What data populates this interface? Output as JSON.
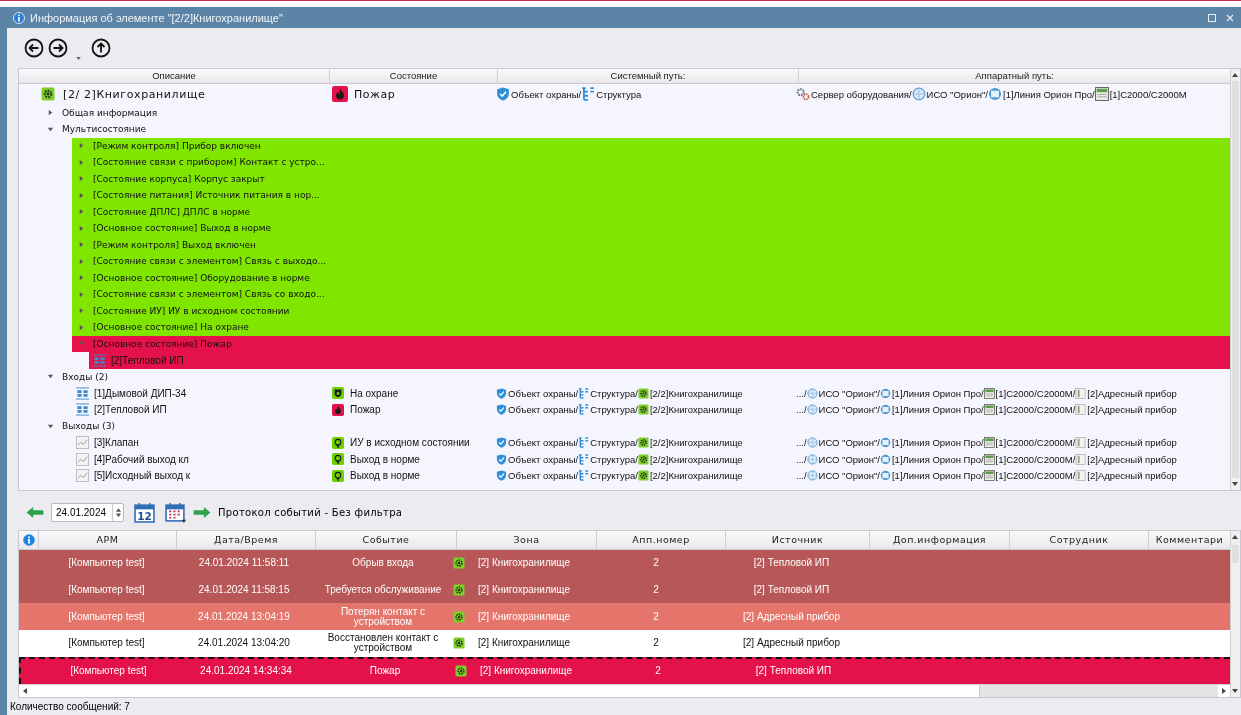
{
  "window": {
    "title": "Информация об элементе \"[2/2]Книгохранилище\""
  },
  "tree_columns": [
    "Описание",
    "Состояние",
    "Системный путь:",
    "Аппаратный путь:"
  ],
  "element": {
    "name": "[2/ 2]Книгохранилище",
    "status": {
      "kind": "fire",
      "text": "Пожар"
    },
    "sys_path": [
      {
        "kind": "shield",
        "text": "Объект охраны/"
      },
      {
        "kind": "structure",
        "text": "Структура"
      }
    ],
    "hw_path": [
      {
        "kind": "gears",
        "text": "Сервер оборудования/"
      },
      {
        "kind": "orion",
        "text": "ИСО \"Орион\"/"
      },
      {
        "kind": "line",
        "text": "[1]Линия Орион Про/"
      },
      {
        "kind": "device",
        "text": "[1]С2000/С2000М"
      }
    ]
  },
  "tree": [
    {
      "label": "Общая информация",
      "expanded": false
    },
    {
      "label": "Мультисостояние",
      "expanded": true,
      "children": [
        {
          "label": "[Режим контроля] Прибор включен",
          "expanded": false,
          "color": "#80e600"
        },
        {
          "label": "[Состояние связи с прибором] Контакт с устро...",
          "expanded": false,
          "color": "#80e600"
        },
        {
          "label": "[Состояние корпуса] Корпус закрыт",
          "expanded": false,
          "color": "#80e600"
        },
        {
          "label": "[Состояние питания] Источник питания в нор...",
          "expanded": false,
          "color": "#80e600"
        },
        {
          "label": "[Состояние ДПЛС] ДПЛС в норме",
          "expanded": false,
          "color": "#80e600"
        },
        {
          "label": "[Основное состояние] Выход в норме",
          "expanded": false,
          "color": "#80e600"
        },
        {
          "label": "[Режим контроля] Выход включен",
          "expanded": false,
          "color": "#80e600"
        },
        {
          "label": "[Состояние связи с элементом] Связь с выходо...",
          "expanded": false,
          "color": "#80e600"
        },
        {
          "label": "[Основное состояние] Оборудование в норме",
          "expanded": false,
          "color": "#80e600"
        },
        {
          "label": "[Состояние связи с элементом] Связь со входо...",
          "expanded": false,
          "color": "#80e600"
        },
        {
          "label": "[Состояние ИУ] ИУ в исходном состоянии",
          "expanded": false,
          "color": "#80e600"
        },
        {
          "label": "[Основное состояние] На охране",
          "expanded": false,
          "color": "#80e600"
        },
        {
          "label": "[Основное состояние] Пожар",
          "expanded": true,
          "color": "#e5114a",
          "children": [
            {
              "label": "[2]Тепловой ИП",
              "kind": "sensor",
              "color": "#e5114a"
            }
          ]
        }
      ]
    },
    {
      "label": "Входы (2)",
      "expanded": true,
      "children": [
        {
          "label": "[1]Дымовой ДИП-34",
          "kind": "sensor",
          "status": {
            "kind": "guard",
            "text": "На охране"
          },
          "sys_path": [
            {
              "kind": "shield",
              "text": "Объект охраны/"
            },
            {
              "kind": "structure",
              "text": "Структура/"
            },
            {
              "kind": "zone",
              "text": "[2/2]Книгохранилище"
            }
          ],
          "hw_path": [
            {
              "kind": "none",
              "text": ".../"
            },
            {
              "kind": "orion",
              "text": "ИСО \"Орион\"/"
            },
            {
              "kind": "line",
              "text": "[1]Линия Орион Про/"
            },
            {
              "kind": "device",
              "text": "[1]С2000/С2000М/"
            },
            {
              "kind": "addr",
              "text": "[2]Адресный прибор"
            }
          ]
        },
        {
          "label": "[2]Тепловой ИП",
          "kind": "sensor",
          "status": {
            "kind": "fire",
            "text": "Пожар"
          },
          "sys_path": [
            {
              "kind": "shield",
              "text": "Объект охраны/"
            },
            {
              "kind": "structure",
              "text": "Структура/"
            },
            {
              "kind": "zone",
              "text": "[2/2]Книгохранилище"
            }
          ],
          "hw_path": [
            {
              "kind": "none",
              "text": ".../"
            },
            {
              "kind": "orion",
              "text": "ИСО \"Орион\"/"
            },
            {
              "kind": "line",
              "text": "[1]Линия Орион Про/"
            },
            {
              "kind": "device",
              "text": "[1]С2000/С2000М/"
            },
            {
              "kind": "addr",
              "text": "[2]Адресный прибор"
            }
          ]
        }
      ]
    },
    {
      "label": "Выходы (3)",
      "expanded": true,
      "children": [
        {
          "label": "[3]Клапан",
          "kind": "output",
          "status": {
            "kind": "bulb",
            "text": "ИУ в исходном состоянии"
          },
          "sys_path": [
            {
              "kind": "shield",
              "text": "Объект охраны/"
            },
            {
              "kind": "structure",
              "text": "Структура/"
            },
            {
              "kind": "zone",
              "text": "[2/2]Книгохранилище"
            }
          ],
          "hw_path": [
            {
              "kind": "none",
              "text": ".../"
            },
            {
              "kind": "orion",
              "text": "ИСО \"Орион\"/"
            },
            {
              "kind": "line",
              "text": "[1]Линия Орион Про/"
            },
            {
              "kind": "device",
              "text": "[1]С2000/С2000М/"
            },
            {
              "kind": "addr",
              "text": "[2]Адресный прибор"
            }
          ]
        },
        {
          "label": "[4]Рабочий выход кл",
          "kind": "output",
          "status": {
            "kind": "bulb",
            "text": "Выход в норме"
          },
          "sys_path": [
            {
              "kind": "shield",
              "text": "Объект охраны/"
            },
            {
              "kind": "structure",
              "text": "Структура/"
            },
            {
              "kind": "zone",
              "text": "[2/2]Книгохранилище"
            }
          ],
          "hw_path": [
            {
              "kind": "none",
              "text": ".../"
            },
            {
              "kind": "orion",
              "text": "ИСО \"Орион\"/"
            },
            {
              "kind": "line",
              "text": "[1]Линия Орион Про/"
            },
            {
              "kind": "device",
              "text": "[1]С2000/С2000М/"
            },
            {
              "kind": "addr",
              "text": "[2]Адресный прибор"
            }
          ]
        },
        {
          "label": "[5]Исходный выход к",
          "kind": "output",
          "status": {
            "kind": "bulb",
            "text": "Выход в норме"
          },
          "sys_path": [
            {
              "kind": "shield",
              "text": "Объект охраны/"
            },
            {
              "kind": "structure",
              "text": "Структура/"
            },
            {
              "kind": "zone",
              "text": "[2/2]Книгохранилище"
            }
          ],
          "hw_path": [
            {
              "kind": "none",
              "text": ".../"
            },
            {
              "kind": "orion",
              "text": "ИСО \"Орион\"/"
            },
            {
              "kind": "line",
              "text": "[1]Линия Орион Про/"
            },
            {
              "kind": "device",
              "text": "[1]С2000/С2000М/"
            },
            {
              "kind": "addr",
              "text": "[2]Адресный прибор"
            }
          ]
        }
      ]
    }
  ],
  "log_toolbar": {
    "date": "24.01.2024",
    "today_label": "12",
    "title": "Протокол событий - Без фильтра"
  },
  "events": {
    "columns": [
      "АРМ",
      "Дата/Время",
      "Событие",
      "Зона",
      "Апп.номер",
      "Источник",
      "Доп.информация",
      "Сотрудник",
      "Комментари"
    ],
    "rows": [
      {
        "color": "#b85757",
        "selected": false,
        "arm": "[Компьютер test]",
        "datetime": "24.01.2024 11:58:11",
        "event": "Обрыв входа",
        "zone": "[2] Книгохранилище",
        "app_number": "2",
        "source": "[2] Тепловой ИП"
      },
      {
        "color": "#b85757",
        "selected": false,
        "arm": "[Компьютер test]",
        "datetime": "24.01.2024 11:58:15",
        "event": "Требуется обслуживание",
        "zone": "[2] Книгохранилище",
        "app_number": "2",
        "source": "[2] Тепловой ИП"
      },
      {
        "color": "#e5756a",
        "selected": false,
        "arm": "[Компьютер test]",
        "datetime": "24.01.2024 13:04:19",
        "event": "Потерян контакт с устройством",
        "zone": "[2] Книгохранилище",
        "app_number": "2",
        "source": "[2] Адресный прибор"
      },
      {
        "color": "#ffffff",
        "selected": false,
        "arm": "[Компьютер test]",
        "datetime": "24.01.2024 13:04:20",
        "event": "Восстановлен контакт с устройством",
        "zone": "[2] Книгохранилище",
        "app_number": "2",
        "source": "[2] Адресный прибор"
      },
      {
        "color": "#e5114a",
        "selected": true,
        "arm": "[Компьютер test]",
        "datetime": "24.01.2024 14:34:34",
        "event": "Пожар",
        "zone": "[2] Книгохранилище",
        "app_number": "2",
        "source": "[2] Тепловой ИП"
      }
    ]
  },
  "status_bar": "Количество сообщений: 7"
}
